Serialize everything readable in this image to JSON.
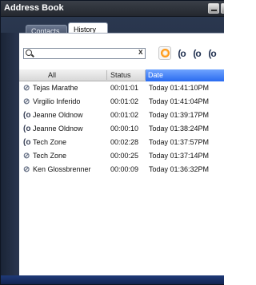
{
  "window": {
    "title": "Address Book"
  },
  "tabs": [
    {
      "label": "Contacts"
    },
    {
      "label": "History"
    }
  ],
  "search": {
    "value": "",
    "clear_glyph": "x"
  },
  "filters": [
    {
      "name": "all-calls-filter-icon"
    },
    {
      "name": "incoming-calls-filter-icon",
      "glyph": "(o"
    },
    {
      "name": "outgoing-calls-filter-icon",
      "glyph": "(o"
    },
    {
      "name": "missed-calls-filter-icon",
      "glyph": "(o"
    }
  ],
  "columns": {
    "name": "All",
    "status": "Status",
    "date": "Date"
  },
  "history": [
    {
      "name": "Tejas Marathe",
      "duration": "00:01:01",
      "date": "Today 01:41:10PM",
      "icon": "outgoing-call-icon"
    },
    {
      "name": "Virgilio Inferido",
      "duration": "00:01:02",
      "date": "Today 01:41:04PM",
      "icon": "outgoing-call-icon"
    },
    {
      "name": "Jeanne Oldnow",
      "duration": "00:01:02",
      "date": "Today 01:39:17PM",
      "icon": "incoming-call-icon"
    },
    {
      "name": "Jeanne Oldnow",
      "duration": "00:00:10",
      "date": "Today 01:38:24PM",
      "icon": "incoming-call-icon"
    },
    {
      "name": "Tech Zone",
      "duration": "00:02:28",
      "date": "Today 01:37:57PM",
      "icon": "incoming-call-icon"
    },
    {
      "name": "Tech Zone",
      "duration": "00:00:25",
      "date": "Today 01:37:14PM",
      "icon": "outgoing-call-icon"
    },
    {
      "name": "Ken Glossbrenner",
      "duration": "00:00:09",
      "date": "Today 01:36:32PM",
      "icon": "outgoing-call-icon"
    }
  ],
  "colors": {
    "accent": "#2a6bf0",
    "filter_all": "#ff9a1a",
    "titlebar": "#24282f"
  }
}
